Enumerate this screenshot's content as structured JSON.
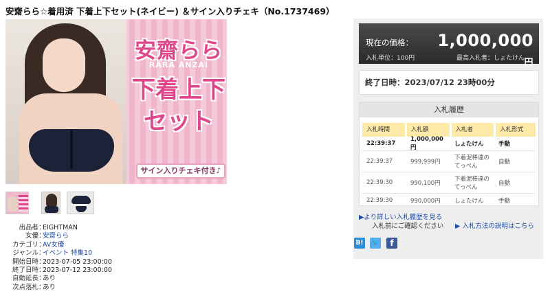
{
  "title": "安齋らら☆着用済 下着上下セット(ネイビー) ＆サイン入りチェキ（No.1737469）",
  "image": {
    "name_jp": "安齋らら",
    "name_en": "RARA ANZAI",
    "headline_line1": "下着上下",
    "headline_line2": "セット",
    "tag": "サイン入りチェキ付き♪"
  },
  "details": [
    {
      "label": "出品者",
      "value": "EIGHTMAN",
      "link": false
    },
    {
      "label": "女優",
      "value": "安齋らら",
      "link": true
    },
    {
      "label": "カテゴリ",
      "value": "AV女優",
      "link": true
    },
    {
      "label": "ジャンル",
      "value": "イベント 特集10",
      "link": true
    },
    {
      "label": "開始日時",
      "value": "2023-07-05 23:00:00",
      "link": false
    },
    {
      "label": "終了日時",
      "value": "2023-07-12 23:00:00",
      "link": false
    },
    {
      "label": "自動延長",
      "value": "あり",
      "link": false
    },
    {
      "label": "次点落札",
      "value": "あり",
      "link": false
    }
  ],
  "price": {
    "label": "現在の価格：",
    "value": "1,000,000",
    "unit": "円",
    "increment": "入札単位：100円",
    "top_bidder": "最高入札者：しょたけん"
  },
  "end_time": "終了日時：2023/07/12 23時00分",
  "history": {
    "title": "入札履歴",
    "headers": [
      "入札時間",
      "入札額",
      "入札者",
      "入札形式"
    ],
    "rows": [
      {
        "time": "22:39:37",
        "amount": "1,000,000円",
        "bidder": "しょたけん",
        "type": "手動"
      },
      {
        "time": "22:39:37",
        "amount": "999,999円",
        "bidder": "下着泥棒達のてっぺん",
        "type": "自動"
      },
      {
        "time": "22:39:30",
        "amount": "990,100円",
        "bidder": "下着泥棒達のてっぺん",
        "type": "自動"
      },
      {
        "time": "22:39:30",
        "amount": "990,000円",
        "bidder": "しょたけん",
        "type": "手動"
      }
    ]
  },
  "links": {
    "more_history": "▶より詳しい入札履歴を見る",
    "confirm": "入札前にご確認ください",
    "help": "▶ 入札方法の説明はこちら"
  },
  "social": {
    "hatena": "B!",
    "twitter": "🐦",
    "facebook": "f"
  },
  "colors": {
    "accent_pink": "#e0468a",
    "link_blue": "#1f4ea8",
    "header_yellow": "#fde9a8"
  }
}
